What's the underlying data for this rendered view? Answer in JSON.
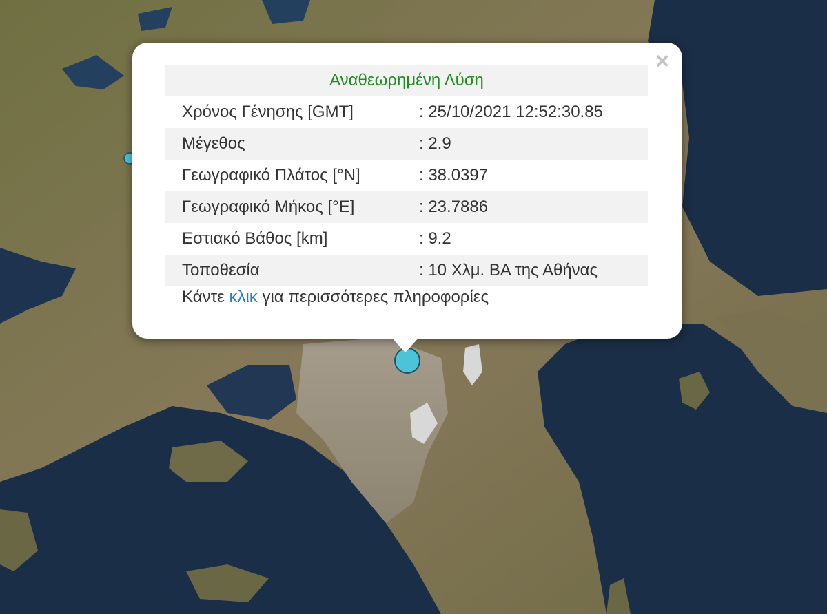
{
  "popup": {
    "title": "Αναθεωρημένη Λύση",
    "close_symbol": "×",
    "rows": [
      {
        "label": "Χρόνος Γένησης [GMT]",
        "value": ": 25/10/2021 12:52:30.85"
      },
      {
        "label": "Μέγεθος",
        "value": ": 2.9"
      },
      {
        "label": "Γεωγραφικό Πλάτος [°N]",
        "value": ": 38.0397"
      },
      {
        "label": "Γεωγραφικό Μήκος [°E]",
        "value": ": 23.7886"
      },
      {
        "label": "Εστιακό Βάθος [km]",
        "value": ": 9.2"
      },
      {
        "label": "Τοποθεσία",
        "value": ": 10 Χλμ. ΒΑ της Αθήνας"
      }
    ],
    "more_prefix": "Κάντε",
    "more_link": "κλικ",
    "more_suffix": "για περισσότερες πληροφορίες",
    "title_color": "#228b22",
    "link_color": "#2a7fb8"
  },
  "map": {
    "marker_color": "#4cc3d9",
    "sea_color": "#1b2e47",
    "land_color": "#7d7450"
  }
}
